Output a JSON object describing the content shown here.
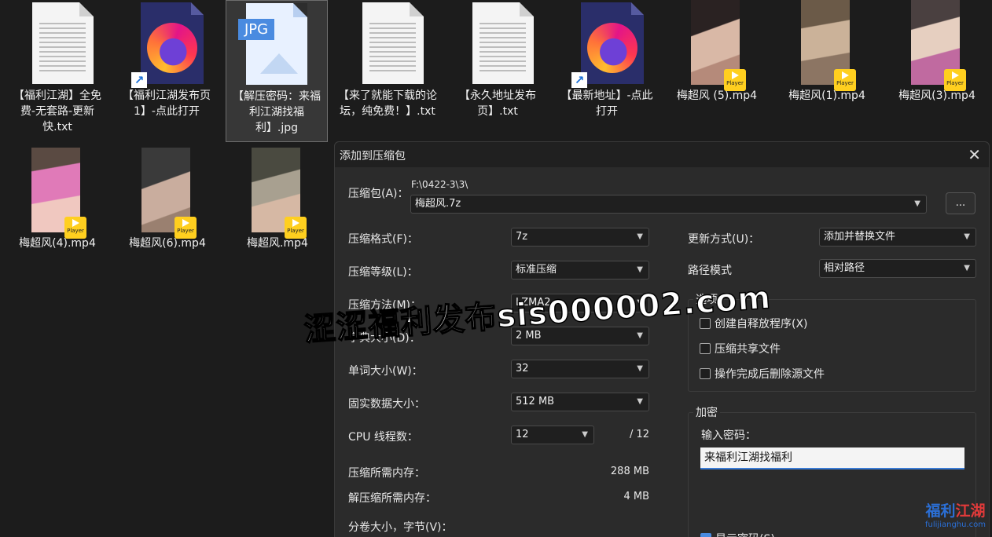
{
  "files": [
    {
      "label": "【福利江湖】全免费-无套路-更新快.txt",
      "icon": "txt"
    },
    {
      "label": "【福利江湖发布页1】-点此打开",
      "icon": "firefox-shortcut"
    },
    {
      "label": "【解压密码：来福利江湖找福利】.jpg",
      "icon": "jpg",
      "badge": "JPG"
    },
    {
      "label": "【来了就能下载的论坛，纯免费！】.txt",
      "icon": "txt"
    },
    {
      "label": "【永久地址发布页】.txt",
      "icon": "txt"
    },
    {
      "label": "【最新地址】-点此打开",
      "icon": "firefox-shortcut"
    },
    {
      "label": "梅超风 (5).mp4",
      "icon": "video"
    },
    {
      "label": "梅超风(1).mp4",
      "icon": "video"
    },
    {
      "label": "梅超风(3).mp4",
      "icon": "video"
    },
    {
      "label": "梅超风(4).mp4",
      "icon": "video"
    },
    {
      "label": "梅超风(6).mp4",
      "icon": "video"
    },
    {
      "label": "梅超风.mp4",
      "icon": "video"
    }
  ],
  "player_badge": "Player",
  "dialog": {
    "title": "添加到压缩包",
    "archive_label": "压缩包(A)：",
    "archive_path": "F:\\0422-3\\3\\",
    "archive_name": "梅超风.7z",
    "browse_label": "...",
    "format_label": "压缩格式(F)：",
    "format_value": "7z",
    "level_label": "压缩等级(L)：",
    "level_value": "标准压缩",
    "method_label": "压缩方法(M)：",
    "method_value": "LZMA2",
    "dict_label": "字典大小(D)：",
    "dict_value": "2 MB",
    "word_label": "单词大小(W)：",
    "word_value": "32",
    "solid_label": "固实数据大小：",
    "solid_value": "512 MB",
    "cpu_label": "CPU 线程数：",
    "cpu_value": "12",
    "cpu_total": "/ 12",
    "mem_comp_label": "压缩所需内存：",
    "mem_comp_value": "288 MB",
    "mem_decomp_label": "解压缩所需内存：",
    "mem_decomp_value": "4 MB",
    "split_label": "分卷大小，字节(V)：",
    "update_label": "更新方式(U)：",
    "update_value": "添加并替换文件",
    "path_label": "路径模式",
    "path_value": "相对路径",
    "options_title": "选项",
    "opt_sfx": "创建自释放程序(X)",
    "opt_shared": "压缩共享文件",
    "opt_delete": "操作完成后删除源文件",
    "enc_title": "加密",
    "pwd_label": "输入密码：",
    "pwd_value": "来福利江湖找福利",
    "show_pwd": "显示密码(S)"
  },
  "watermark": "涩涩福利发布sis000002.com",
  "logo": {
    "line1a": "福利",
    "line1b": "江湖",
    "line2": "fulijianghu.com"
  }
}
